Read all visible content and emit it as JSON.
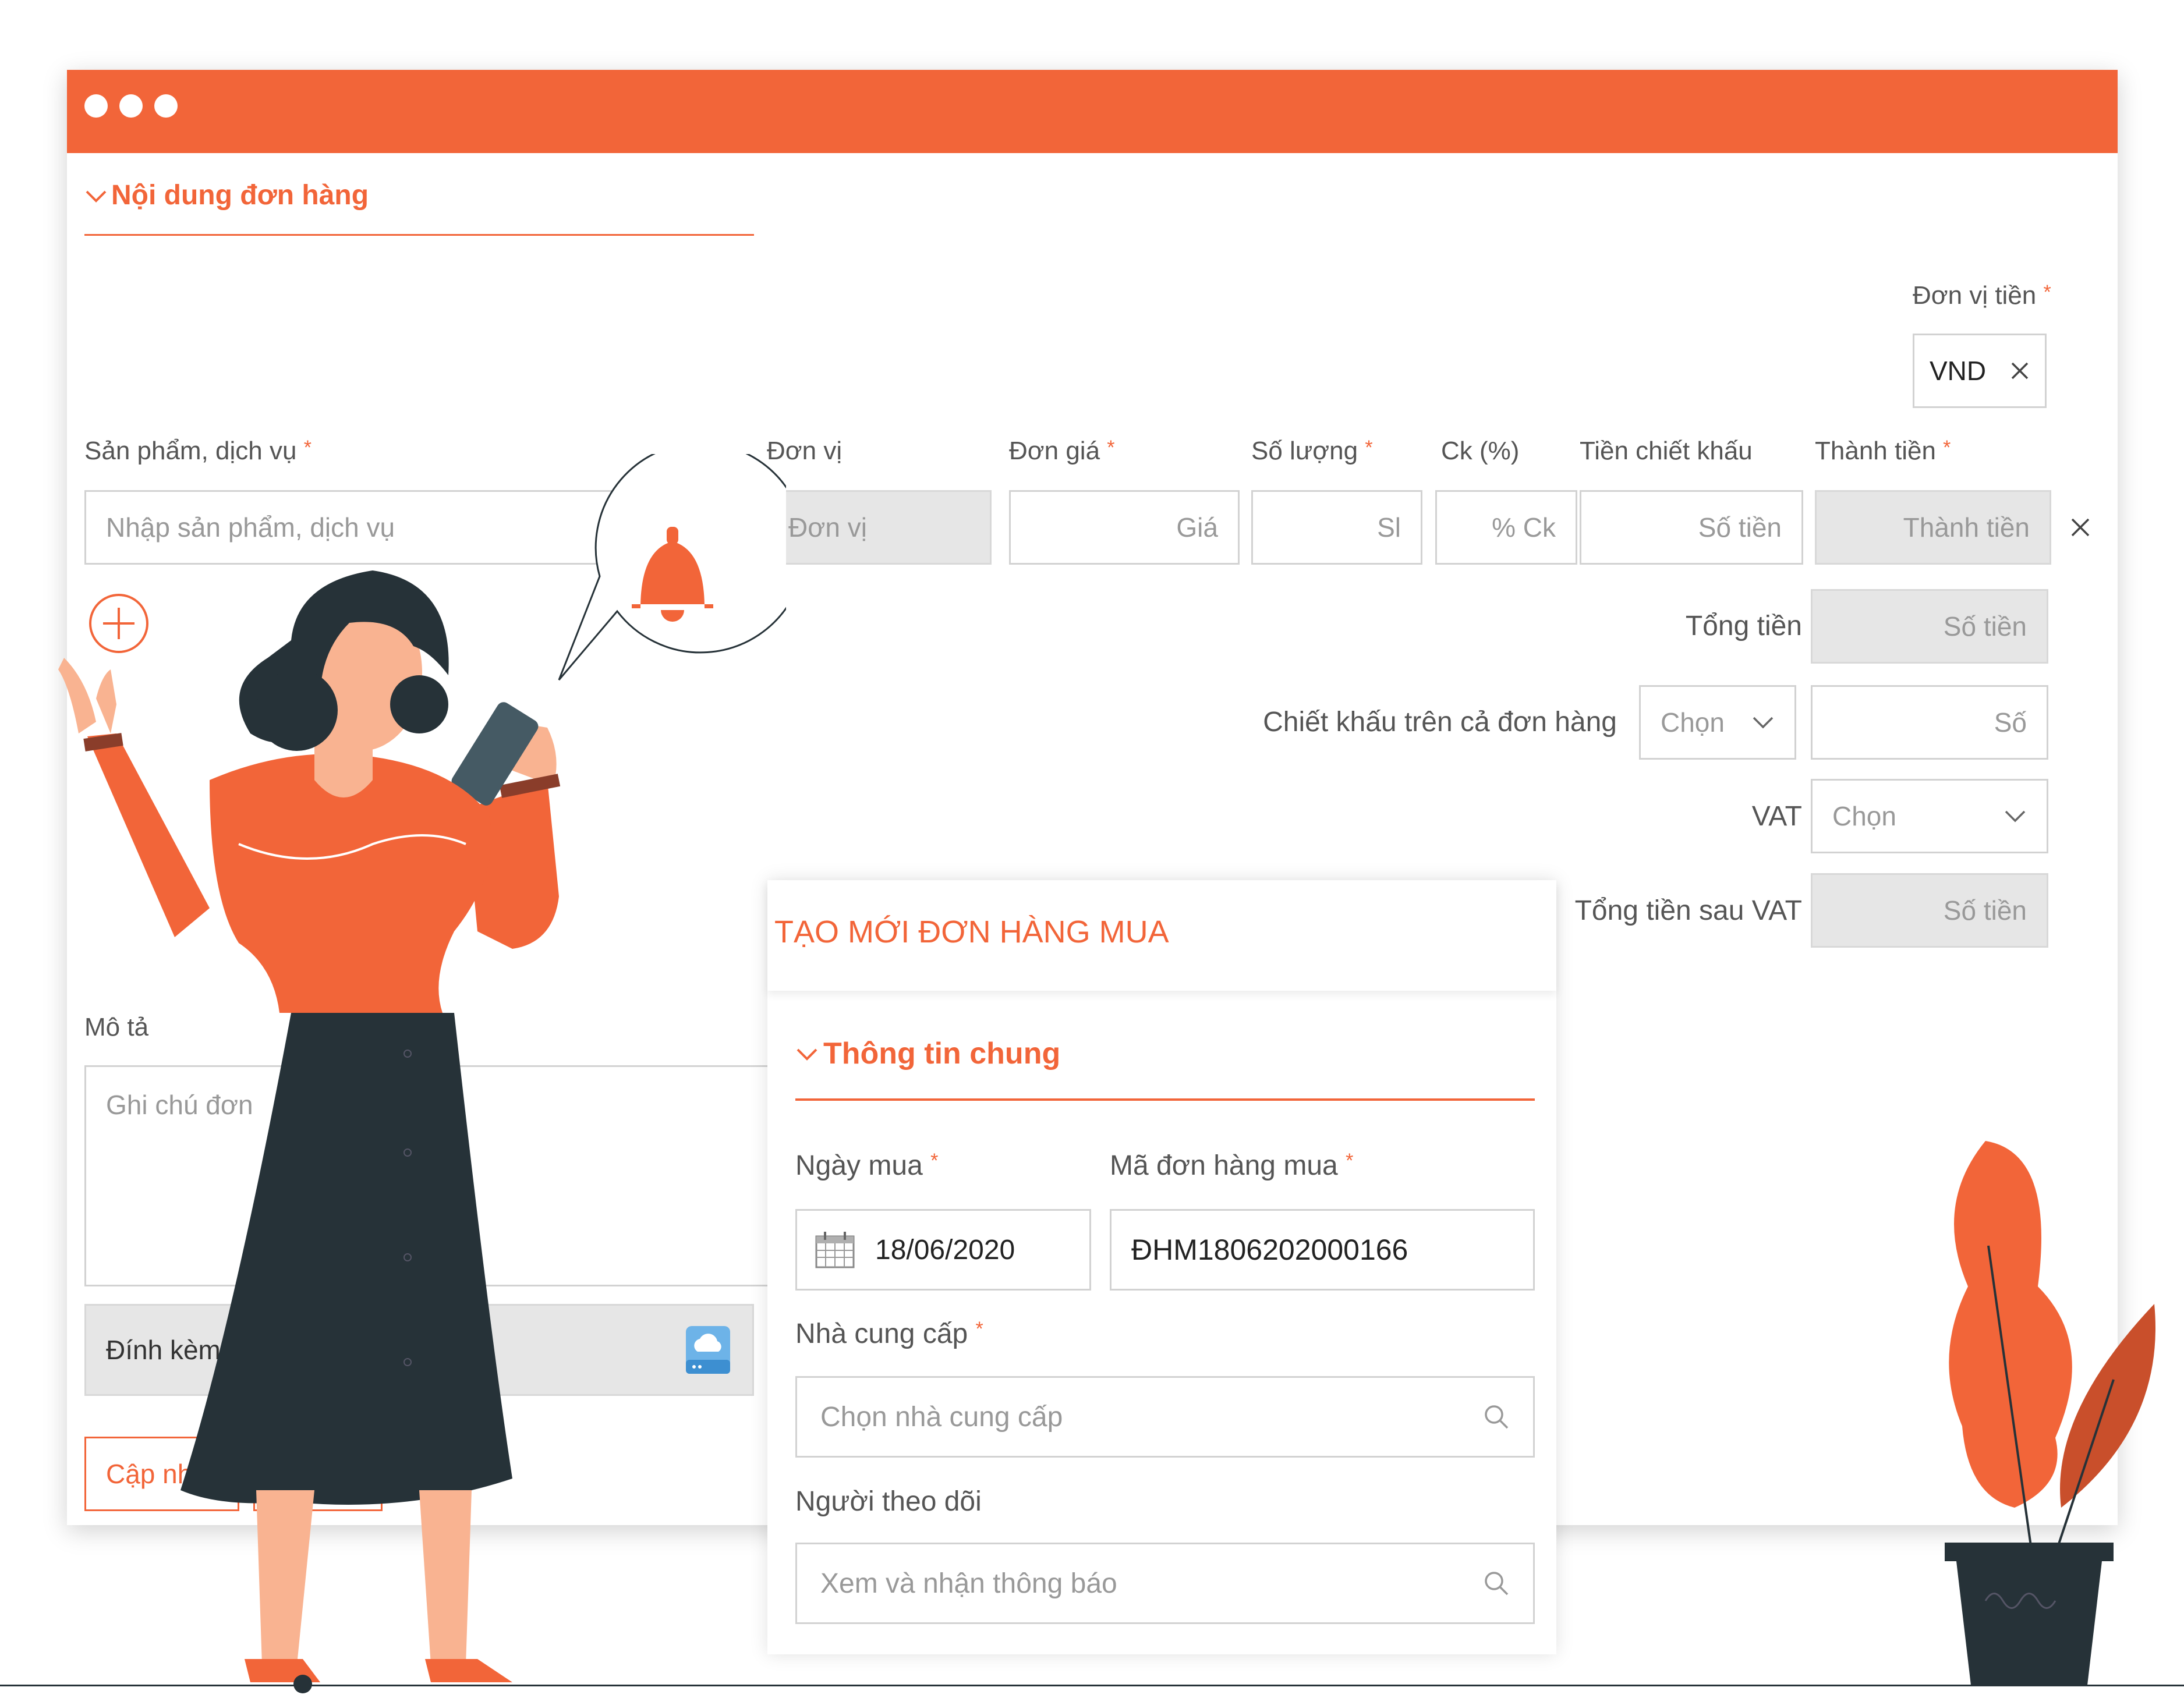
{
  "window": {
    "section_title": "Nội dung đơn hàng",
    "currency": {
      "label": "Đơn vị tiền",
      "value": "VND"
    },
    "columns": {
      "product": {
        "label": "Sản phẩm, dịch vụ",
        "placeholder": "Nhập sản phẩm, dịch vụ"
      },
      "unit": {
        "label": "Đơn vị",
        "placeholder": "Đơn vị"
      },
      "price": {
        "label": "Đơn giá",
        "placeholder": "Giá"
      },
      "quantity": {
        "label": "Số lượng",
        "placeholder": "Sl"
      },
      "discount_pct": {
        "label": "Ck (%)",
        "placeholder": "% Ck"
      },
      "discount_amount": {
        "label": "Tiền chiết khấu",
        "placeholder": "Số tiền"
      },
      "line_total": {
        "label": "Thành tiền",
        "placeholder": "Thành tiền"
      }
    },
    "totals": {
      "total": {
        "label": "Tổng tiền",
        "placeholder": "Số tiền"
      },
      "order_discount": {
        "label": "Chiết khấu trên cả đơn hàng",
        "select": "Chọn",
        "placeholder": "Số"
      },
      "vat": {
        "label": "VAT",
        "select": "Chọn"
      },
      "total_after_vat": {
        "label": "Tổng tiền sau VAT",
        "placeholder": "Số tiền"
      }
    },
    "description": {
      "label": "Mô tả",
      "placeholder": "Ghi chú đơn"
    },
    "attachment": {
      "label": "Đính kèm"
    },
    "update_button": "Cập nhật"
  },
  "card": {
    "title": "TẠO MỚI ĐƠN HÀNG MUA",
    "section_title": "Thông tin chung",
    "purchase_date": {
      "label": "Ngày mua",
      "value": "18/06/2020"
    },
    "order_code": {
      "label": "Mã đơn hàng mua",
      "value": "ĐHM1806202000166"
    },
    "supplier": {
      "label": "Nhà cung cấp",
      "placeholder": "Chọn nhà cung cấp"
    },
    "followers": {
      "label": "Người theo dõi",
      "placeholder": "Xem và nhận thông báo"
    }
  },
  "colors": {
    "accent": "#f26539",
    "dark": "#263238",
    "skin": "#f9b391"
  },
  "icons": [
    "search-icon",
    "close-icon",
    "add-circle-icon",
    "chevron-down-icon",
    "calendar-icon",
    "cloud-upload-icon",
    "bell-icon"
  ]
}
